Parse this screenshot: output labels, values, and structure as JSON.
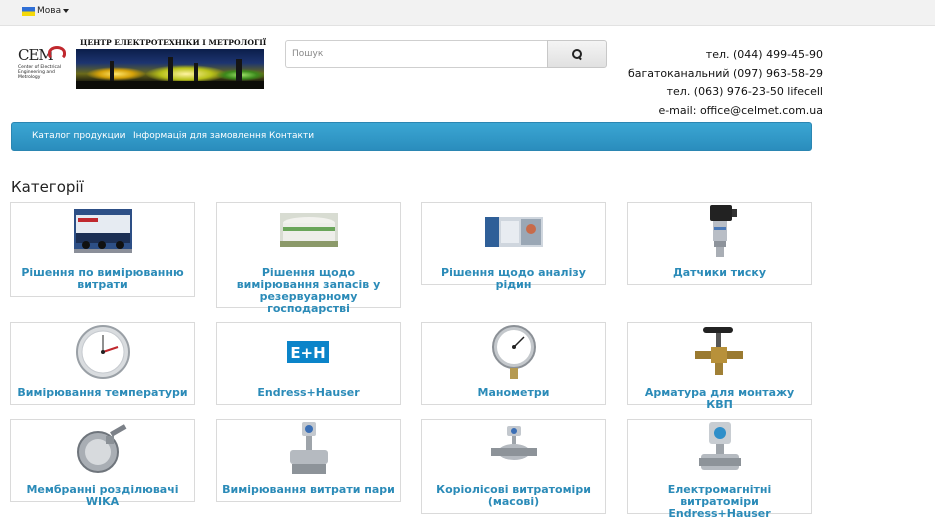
{
  "topbar": {
    "language_label": "Мова"
  },
  "brand": {
    "logo_abbr": "CEM",
    "logo_subtitle": "Center of Electrical Engineering and Metrology",
    "title": "ЦЕНТР ЕЛЕКТРОТЕХНІКИ І МЕТРОЛОГІЇ"
  },
  "search": {
    "placeholder": "Пошук"
  },
  "contacts": [
    "тел. (044) 499-45-90",
    "багатоканальний (097) 963-58-29",
    "тел. (063) 976-23-50 lifecell",
    "e-mail: office@celmet.com.ua"
  ],
  "nav": [
    "Каталог продукции",
    "Інформація для замовлення",
    "Контакти"
  ],
  "categories_title": "Категорії",
  "categories": [
    {
      "label": "Рішення по вимірюванню витрати",
      "icon": "truck-icon"
    },
    {
      "label": "Рішення щодо вимірювання запасів у резервуарному господарстві",
      "icon": "tank-icon"
    },
    {
      "label": "Рішення щодо аналізу рідин",
      "icon": "lab-equipment-icon"
    },
    {
      "label": "Датчики тиску",
      "icon": "pressure-sensor-icon"
    },
    {
      "label": "Вимірювання температури",
      "icon": "thermometer-dial-icon"
    },
    {
      "label": "Endress+Hauser",
      "icon": "endress-hauser-logo",
      "logo_text": "E+H"
    },
    {
      "label": "Манометри",
      "icon": "manometer-icon"
    },
    {
      "label": "Арматура для монтажу КВП",
      "icon": "valve-icon"
    },
    {
      "label": "Мембранні розділювачі WIKA",
      "icon": "diaphragm-seal-icon"
    },
    {
      "label": "Вимірювання витрати пари",
      "icon": "steam-flowmeter-icon"
    },
    {
      "label": "Коріолісові витратоміри (масові)",
      "icon": "coriolis-flowmeter-icon"
    },
    {
      "label": "Електромагнітні витратоміри Endress+Hauser",
      "icon": "magnetic-flowmeter-icon"
    }
  ],
  "colors": {
    "accent": "#2b8bb8",
    "nav_bg": "#3399cc",
    "logo_red": "#c0282e"
  }
}
